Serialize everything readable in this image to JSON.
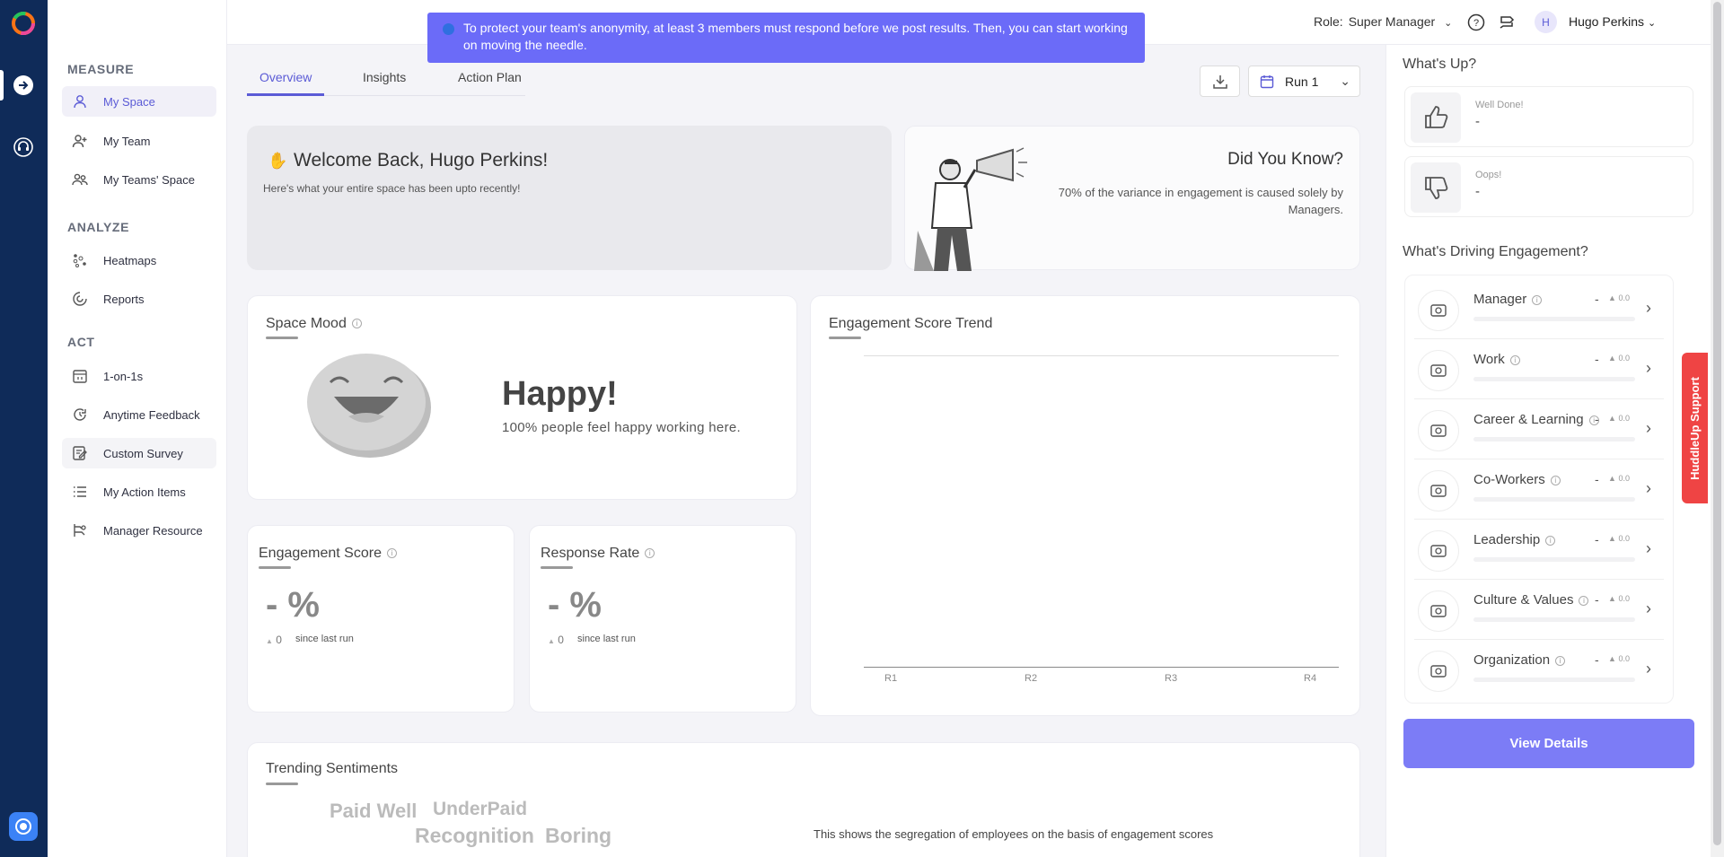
{
  "banner": {
    "text": "To protect your team's anonymity, at least 3 members must respond before we post results. Then, you can start working on moving the needle."
  },
  "header": {
    "role_label": "Role:",
    "role_value": "Super Manager",
    "user_initial": "H",
    "user_name": "Hugo Perkins"
  },
  "sidebar": {
    "sections": [
      {
        "title": "MEASURE",
        "items": [
          {
            "label": "My Space",
            "icon": "person-icon",
            "active": true
          },
          {
            "label": "My Team",
            "icon": "person-add-icon"
          },
          {
            "label": "My Teams' Space",
            "icon": "group-icon"
          }
        ]
      },
      {
        "title": "ANALYZE",
        "items": [
          {
            "label": "Heatmaps",
            "icon": "heatmap-icon"
          },
          {
            "label": "Reports",
            "icon": "reports-icon"
          }
        ]
      },
      {
        "title": "ACT",
        "items": [
          {
            "label": "1-on-1s",
            "icon": "calendar-icon"
          },
          {
            "label": "Anytime Feedback",
            "icon": "feedback-icon"
          },
          {
            "label": "Custom Survey",
            "icon": "survey-icon"
          },
          {
            "label": "My Action Items",
            "icon": "list-icon"
          },
          {
            "label": "Manager Resource",
            "icon": "resource-icon"
          }
        ]
      }
    ]
  },
  "tabs": [
    "Overview",
    "Insights",
    "Action Plan"
  ],
  "run_selector": {
    "value": "Run 1"
  },
  "welcome": {
    "title": "Welcome Back, Hugo Perkins!",
    "subtitle": "Here's what your entire space has been upto recently!"
  },
  "did_you_know": {
    "title": "Did You Know?",
    "text": "70% of the variance in engagement is caused solely by Managers."
  },
  "space_mood": {
    "title": "Space Mood",
    "mood": "Happy!",
    "description": "100% people feel happy working here."
  },
  "engagement_trend": {
    "title": "Engagement Score Trend",
    "x_labels": [
      "R1",
      "R2",
      "R3",
      "R4"
    ]
  },
  "engagement_score": {
    "title": "Engagement Score",
    "value": "- %",
    "delta": "0",
    "since": "since last run"
  },
  "response_rate": {
    "title": "Response Rate",
    "value": "- %",
    "delta": "0",
    "since": "since last run"
  },
  "trending": {
    "title": "Trending Sentiments",
    "words": [
      "Paid Well",
      "UnderPaid",
      "Recognition",
      "Boring"
    ],
    "segregation_text": "This shows the segregation of employees on the basis of engagement scores"
  },
  "whats_up": {
    "title": "What's Up?",
    "cards": [
      {
        "label": "Well Done!",
        "value": "-"
      },
      {
        "label": "Oops!",
        "value": "-"
      }
    ]
  },
  "drivers": {
    "title": "What's Driving Engagement?",
    "items": [
      {
        "name": "Manager",
        "score": "-",
        "delta": "0.0"
      },
      {
        "name": "Work",
        "score": "-",
        "delta": "0.0"
      },
      {
        "name": "Career & Learning",
        "score": "-",
        "delta": "0.0"
      },
      {
        "name": "Co-Workers",
        "score": "-",
        "delta": "0.0"
      },
      {
        "name": "Leadership",
        "score": "-",
        "delta": "0.0"
      },
      {
        "name": "Culture & Values",
        "score": "-",
        "delta": "0.0"
      },
      {
        "name": "Organization",
        "score": "-",
        "delta": "0.0"
      }
    ],
    "view_details": "View Details"
  },
  "support_tab": {
    "label": "HuddleUp Support"
  },
  "colors": {
    "accent": "#5b5bd6",
    "rail": "#0f2b59",
    "banner": "#6b6bf8",
    "support": "#ef4444"
  }
}
